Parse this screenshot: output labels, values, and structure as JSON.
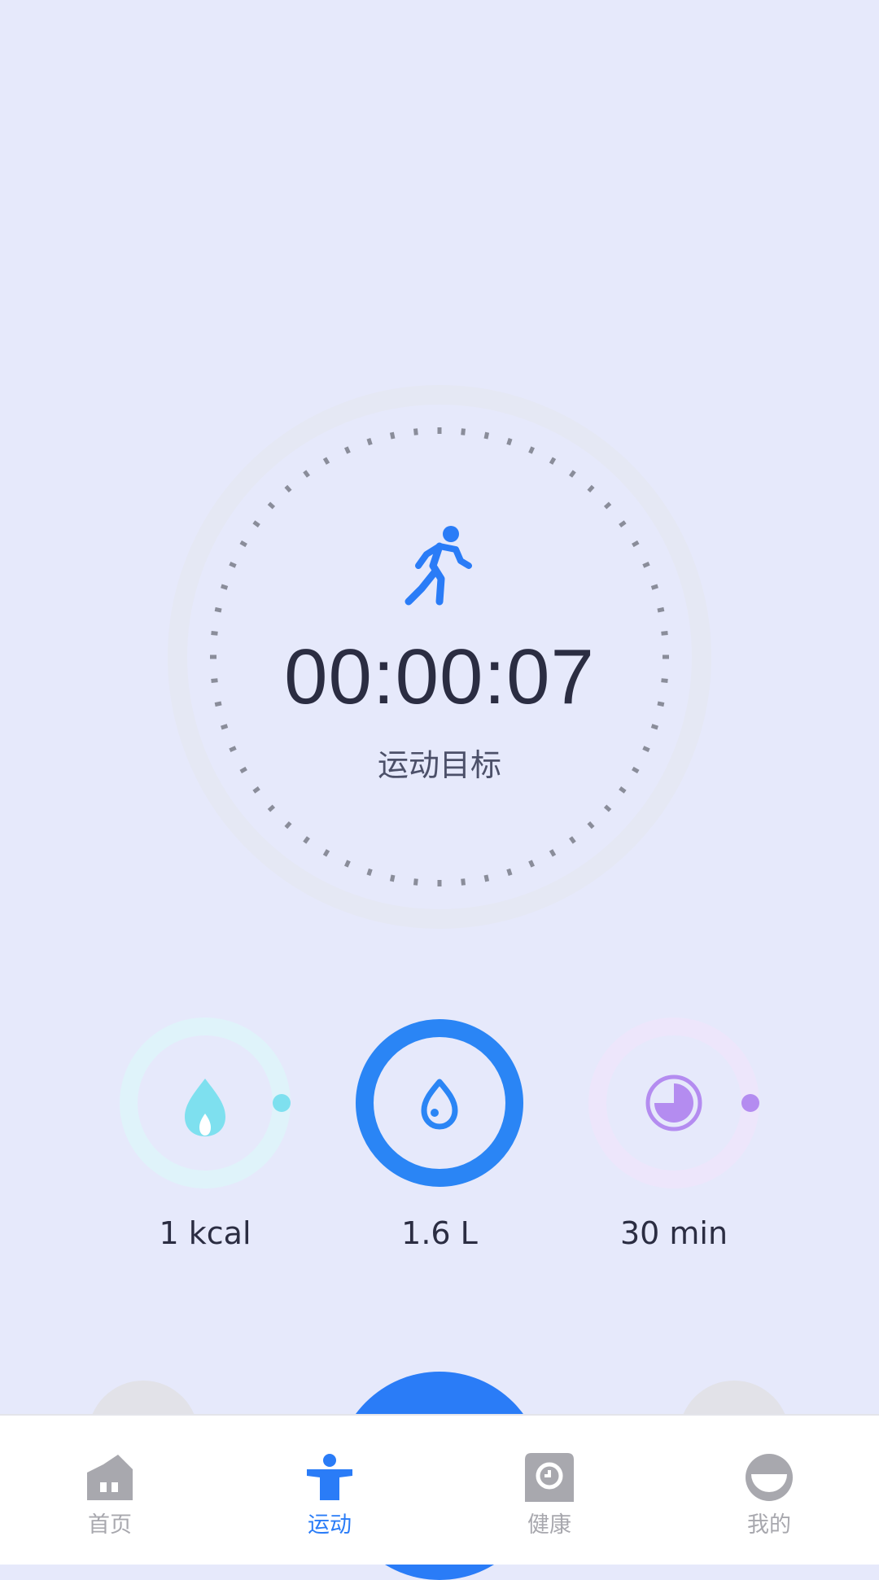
{
  "timer": {
    "elapsed": "00:00:07",
    "goal_label": "运动目标",
    "icon": "running-person-icon"
  },
  "stats": [
    {
      "value": "1 kcal",
      "icon": "flame-icon",
      "color": "#7ee0ef",
      "progress": 0.0
    },
    {
      "value": "1.6 L",
      "icon": "water-drop-icon",
      "color": "#2a85f5",
      "progress": 1.0
    },
    {
      "value": "30 min",
      "icon": "clock-icon",
      "color": "#b48cf0",
      "progress": 0.0
    }
  ],
  "tabbar": {
    "tabs": [
      {
        "label": "首页",
        "icon": "home-icon",
        "active": false
      },
      {
        "label": "运动",
        "icon": "exercise-icon",
        "active": true
      },
      {
        "label": "健康",
        "icon": "health-icon",
        "active": false
      },
      {
        "label": "我的",
        "icon": "profile-icon",
        "active": false
      }
    ],
    "active_color": "#2a7cf7",
    "inactive_color": "#a8a8ae"
  }
}
